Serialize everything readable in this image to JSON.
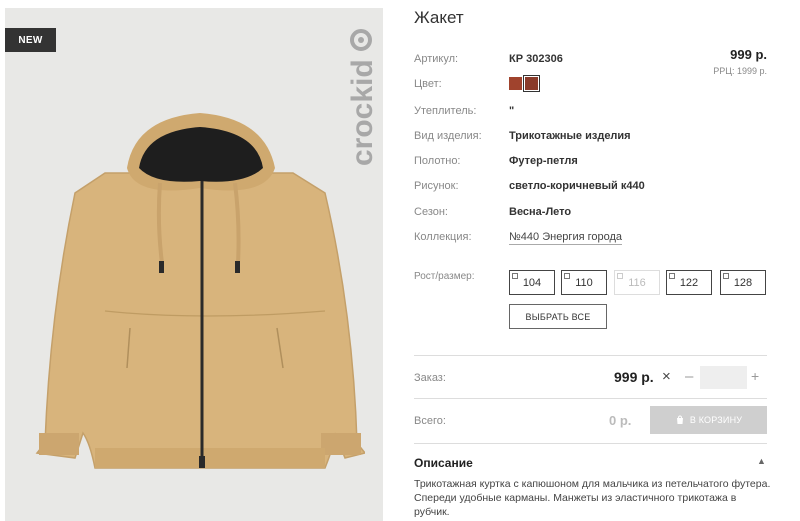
{
  "product": {
    "badge": "NEW",
    "brand": "crockid",
    "title": "Жакет",
    "price": "999 р.",
    "rrc": "РРЦ: 1999 р."
  },
  "details": {
    "article": {
      "label": "Артикул:",
      "value": "КР 302306"
    },
    "color": {
      "label": "Цвет:",
      "swatches": [
        "#a0432d",
        "#8a3b2a"
      ]
    },
    "insulation": {
      "label": "Утеплитель:",
      "value": "\""
    },
    "type": {
      "label": "Вид изделия:",
      "value": "Трикотажные изделия"
    },
    "fabric": {
      "label": "Полотно:",
      "value": "Футер-петля"
    },
    "pattern": {
      "label": "Рисунок:",
      "value": "светло-коричневый к440"
    },
    "season": {
      "label": "Сезон:",
      "value": "Весна-Лето"
    },
    "collection": {
      "label": "Коллекция:",
      "value": "№440 Энергия города"
    }
  },
  "sizes": {
    "label": "Рост/размер:",
    "items": [
      {
        "value": "104",
        "available": true
      },
      {
        "value": "110",
        "available": true
      },
      {
        "value": "116",
        "available": false
      },
      {
        "value": "122",
        "available": true
      },
      {
        "value": "128",
        "available": true
      }
    ],
    "select_all": "ВЫБРАТЬ ВСЕ"
  },
  "order": {
    "label": "Заказ:",
    "price": "999 р.",
    "times": "×",
    "minus": "–",
    "plus": "+",
    "qty_value": ""
  },
  "total": {
    "label": "Всего:",
    "value": "0 р.",
    "cart_button": "В КОРЗИНУ"
  },
  "description": {
    "title": "Описание",
    "text": "Трикотажная куртка с капюшоном для мальчика из петельчатого футера. Спереди удобные карманы. Манжеты из эластичного трикотажа в рубчик."
  },
  "colors": {
    "jacket": "#d8b47c",
    "hood_lining": "#1e1e1e",
    "badge_bg": "#333333",
    "cart_bg": "#cfcfcf"
  }
}
